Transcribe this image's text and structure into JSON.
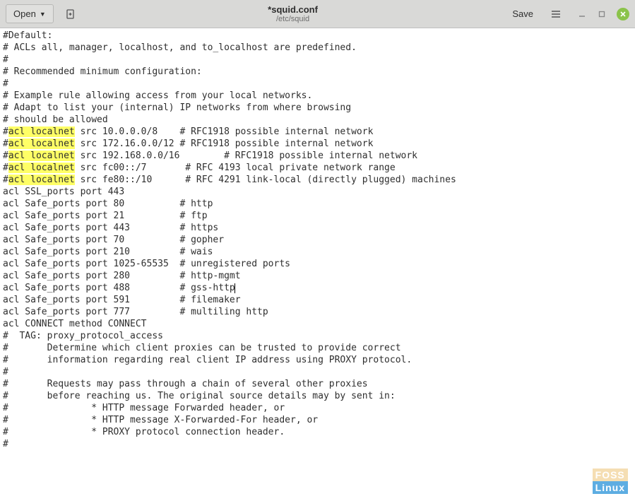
{
  "header": {
    "open_label": "Open",
    "title": "*squid.conf",
    "subtitle": "/etc/squid",
    "save_label": "Save"
  },
  "editor": {
    "highlighted_text": "acl localnet",
    "lines": [
      {
        "segments": [
          {
            "t": "#Default:"
          }
        ]
      },
      {
        "segments": [
          {
            "t": "# ACLs all, manager, localhost, and to_localhost are predefined."
          }
        ]
      },
      {
        "segments": [
          {
            "t": "#"
          }
        ]
      },
      {
        "segments": [
          {
            "t": "# Recommended minimum configuration:"
          }
        ]
      },
      {
        "segments": [
          {
            "t": "#"
          }
        ]
      },
      {
        "segments": [
          {
            "t": ""
          }
        ]
      },
      {
        "segments": [
          {
            "t": "# Example rule allowing access from your local networks."
          }
        ]
      },
      {
        "segments": [
          {
            "t": "# Adapt to list your (internal) IP networks from where browsing"
          }
        ]
      },
      {
        "segments": [
          {
            "t": "# should be allowed"
          }
        ]
      },
      {
        "segments": [
          {
            "t": "#"
          },
          {
            "t": "acl localnet",
            "hl": true
          },
          {
            "t": " src 10.0.0.0/8    # RFC1918 possible internal network"
          }
        ]
      },
      {
        "segments": [
          {
            "t": "#"
          },
          {
            "t": "acl localnet",
            "hl": true
          },
          {
            "t": " src 172.16.0.0/12 # RFC1918 possible internal network"
          }
        ]
      },
      {
        "segments": [
          {
            "t": "#"
          },
          {
            "t": "acl localnet",
            "hl": true
          },
          {
            "t": " src 192.168.0.0/16        # RFC1918 possible internal network"
          }
        ]
      },
      {
        "segments": [
          {
            "t": "#"
          },
          {
            "t": "acl localnet",
            "hl": true
          },
          {
            "t": " src fc00::/7       # RFC 4193 local private network range"
          }
        ]
      },
      {
        "segments": [
          {
            "t": "#"
          },
          {
            "t": "acl localnet",
            "hl": true
          },
          {
            "t": " src fe80::/10      # RFC 4291 link-local (directly plugged) machines"
          }
        ]
      },
      {
        "segments": [
          {
            "t": ""
          }
        ]
      },
      {
        "segments": [
          {
            "t": "acl SSL_ports port 443"
          }
        ]
      },
      {
        "segments": [
          {
            "t": "acl Safe_ports port 80          # http"
          }
        ]
      },
      {
        "segments": [
          {
            "t": "acl Safe_ports port 21          # ftp"
          }
        ]
      },
      {
        "segments": [
          {
            "t": "acl Safe_ports port 443         # https"
          }
        ]
      },
      {
        "segments": [
          {
            "t": "acl Safe_ports port 70          # gopher"
          }
        ]
      },
      {
        "segments": [
          {
            "t": "acl Safe_ports port 210         # wais"
          }
        ]
      },
      {
        "segments": [
          {
            "t": "acl Safe_ports port 1025-65535  # unregistered ports"
          }
        ]
      },
      {
        "segments": [
          {
            "t": "acl Safe_ports port 280         # http-mgmt"
          }
        ]
      },
      {
        "segments": [
          {
            "t": "acl Safe_ports port 488         # gss-http"
          }
        ],
        "cursor_after": true
      },
      {
        "segments": [
          {
            "t": "acl Safe_ports port 591         # filemaker"
          }
        ]
      },
      {
        "segments": [
          {
            "t": "acl Safe_ports port 777         # multiling http"
          }
        ]
      },
      {
        "segments": [
          {
            "t": "acl CONNECT method CONNECT"
          }
        ]
      },
      {
        "segments": [
          {
            "t": ""
          }
        ]
      },
      {
        "segments": [
          {
            "t": "#  TAG: proxy_protocol_access"
          }
        ]
      },
      {
        "segments": [
          {
            "t": "#       Determine which client proxies can be trusted to provide correct"
          }
        ]
      },
      {
        "segments": [
          {
            "t": "#       information regarding real client IP address using PROXY protocol."
          }
        ]
      },
      {
        "segments": [
          {
            "t": "#"
          }
        ]
      },
      {
        "segments": [
          {
            "t": "#       Requests may pass through a chain of several other proxies"
          }
        ]
      },
      {
        "segments": [
          {
            "t": "#       before reaching us. The original source details may by sent in:"
          }
        ]
      },
      {
        "segments": [
          {
            "t": "#               * HTTP message Forwarded header, or"
          }
        ]
      },
      {
        "segments": [
          {
            "t": "#               * HTTP message X-Forwarded-For header, or"
          }
        ]
      },
      {
        "segments": [
          {
            "t": "#               * PROXY protocol connection header."
          }
        ]
      },
      {
        "segments": [
          {
            "t": "#"
          }
        ]
      }
    ]
  },
  "watermark": {
    "line1": "FOSS",
    "line2": "Linux"
  }
}
